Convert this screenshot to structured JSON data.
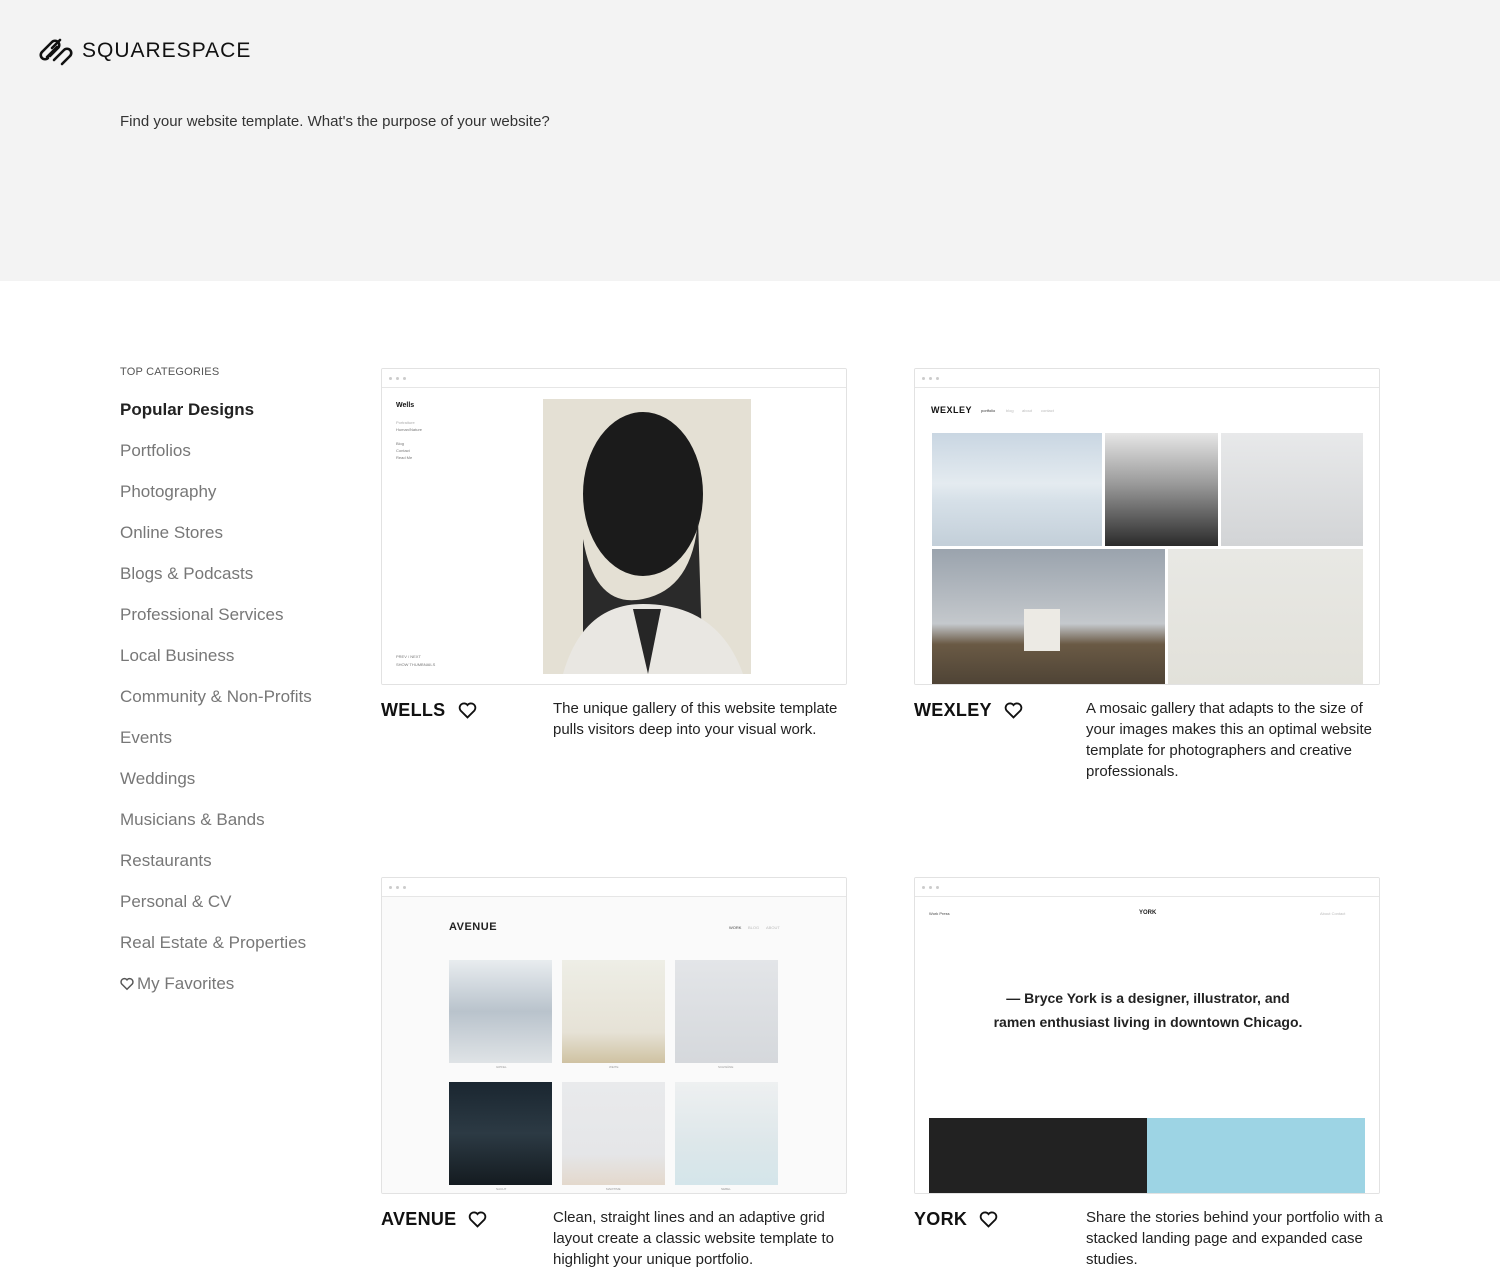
{
  "brand": {
    "name": "SQUARESPACE"
  },
  "header": {
    "prompt": "Find your website template. What's the purpose of your website?"
  },
  "sidebar": {
    "heading": "TOP CATEGORIES",
    "items": [
      {
        "label": "Popular Designs",
        "active": true
      },
      {
        "label": "Portfolios"
      },
      {
        "label": "Photography"
      },
      {
        "label": "Online Stores"
      },
      {
        "label": "Blogs & Podcasts"
      },
      {
        "label": "Professional Services"
      },
      {
        "label": "Local Business"
      },
      {
        "label": "Community & Non-Profits"
      },
      {
        "label": "Events"
      },
      {
        "label": "Weddings"
      },
      {
        "label": "Musicians & Bands"
      },
      {
        "label": "Restaurants"
      },
      {
        "label": "Personal & CV"
      },
      {
        "label": "Real Estate & Properties"
      },
      {
        "label": "My Favorites",
        "icon": "heart-icon"
      }
    ]
  },
  "templates": [
    {
      "name": "WELLS",
      "description": "The unique gallery of this website template pulls visitors deep into your visual work.",
      "preview": {
        "site_title": "Wells",
        "nav": [
          "Portraiture",
          "Human/Nature",
          "Blog",
          "Contact",
          "Read Me"
        ],
        "footer": [
          "PREV / NEXT",
          "SHOW THUMBNAILS"
        ]
      }
    },
    {
      "name": "WEXLEY",
      "description": "A mosaic gallery that adapts to the size of your images makes this an optimal website template for photographers and creative professionals.",
      "preview": {
        "site_title": "WEXLEY",
        "nav": [
          "portfolio",
          "blog",
          "about",
          "contact"
        ]
      }
    },
    {
      "name": "AVENUE",
      "description": "Clean, straight lines and an adaptive grid layout create a classic website template to highlight your unique portfolio.",
      "preview": {
        "site_title": "AVENUE",
        "nav": [
          "WORK",
          "BLOG",
          "ABOUT"
        ],
        "captions": [
          "GIPFEL",
          "WEITE",
          "SCHWÄNE",
          "NACHT",
          "MARITIME",
          "NEBEL"
        ]
      }
    },
    {
      "name": "YORK",
      "description": "Share the stories behind your portfolio with a stacked landing page and expanded case studies.",
      "preview": {
        "site_title": "YORK",
        "nav_left": "Work Press",
        "nav_right": "About Contact",
        "quote_line1": "— Bryce York is a designer, illustrator, and",
        "quote_line2": "ramen enthusiast living in downtown Chicago."
      }
    }
  ]
}
